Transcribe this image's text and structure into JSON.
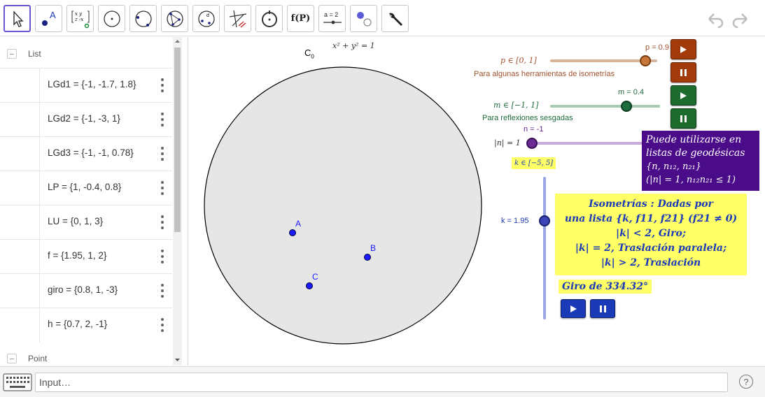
{
  "toolbar": {
    "tools": [
      {
        "name": "move-tool",
        "selected": true
      },
      {
        "name": "point-tool"
      },
      {
        "name": "matrix-tool"
      },
      {
        "name": "circle-center-point-tool"
      },
      {
        "name": "circle-arc-tool"
      },
      {
        "name": "polygon-tool"
      },
      {
        "name": "circle-radius-tool"
      },
      {
        "name": "lines-tool"
      },
      {
        "name": "circle-through-point-tool"
      },
      {
        "name": "function-tool",
        "label": "f(P)"
      },
      {
        "name": "slider-tool",
        "label": "a = 2"
      },
      {
        "name": "show-hide-tool"
      },
      {
        "name": "settings-tool"
      }
    ],
    "undo_icon": "undo-icon",
    "redo_icon": "redo-icon"
  },
  "algebra": {
    "group_list": "List",
    "group_point": "Point",
    "rows": [
      {
        "expr": "LGd1 = {-1, -1.7, 1.8}"
      },
      {
        "expr": "LGd2 = {-1, -3, 1}"
      },
      {
        "expr": "LGd3 = {-1, -1, 0.78}"
      },
      {
        "expr": "LP = {1, -0.4, 0.8}"
      },
      {
        "expr": "LU = {0, 1, 3}"
      },
      {
        "expr": "f = {1.95, 1, 2}"
      },
      {
        "expr": "giro = {0.8, 1, -3}"
      },
      {
        "expr": "h = {0.7, 2, -1}"
      }
    ]
  },
  "graphics": {
    "circle_label": "C",
    "circle_label_sub": "0",
    "circle_equation": "x² + y² = 1",
    "points": [
      {
        "label": "A"
      },
      {
        "label": "B"
      },
      {
        "label": "C"
      }
    ],
    "slider_p": {
      "value_label": "p = 0.9",
      "range_label": "p ∈ [0, 1]",
      "caption": "Para algunas herramientas de isometrías",
      "value": 0.9,
      "min": 0,
      "max": 1,
      "color": "#c7773a"
    },
    "slider_m": {
      "value_label": "m = 0.4",
      "range_label": "m ∈ [−1, 1]",
      "caption": "Para reflexiones sesgadas",
      "value": 0.4,
      "min": -1,
      "max": 1,
      "color": "#1e6b3c"
    },
    "slider_n": {
      "value_label": "n = -1",
      "range_label": "|n| = 1",
      "value": -1,
      "color": "#7b3aa3"
    },
    "slider_k": {
      "value_label": "k = 1.95",
      "range_label": "k ∈ [−5, 5]",
      "value": 1.95,
      "min": -5,
      "max": 5,
      "color": "#3b45b8"
    },
    "note_purple": {
      "line1": "Puede utilizarse en",
      "line2": "listas de geodésicas",
      "line3": "{n, n₁₂, n₂₁}",
      "line4": "(|n| = 1, n₁₂n₂₁ ≤ 1)",
      "bg": "#4b0c8a"
    },
    "note_yellow": {
      "line1": "Isometrías : Dadas por",
      "line2": "una lista {k, f11, f21} (f21 ≠ 0)",
      "line3": "|k| < 2, Giro;",
      "line4": "|k| = 2, Traslación paralela;",
      "line5": "|k| > 2, Traslación",
      "bg": "#ffff66"
    },
    "giro_label": "Giro de 334.32°",
    "play_color_brown": "#a33a0c",
    "play_color_green": "#1d6b2d",
    "play_color_blue": "#1a3ab8"
  },
  "inputbar": {
    "placeholder": "Input…",
    "keyboard_icon": "keyboard-icon",
    "help_label": "?"
  }
}
